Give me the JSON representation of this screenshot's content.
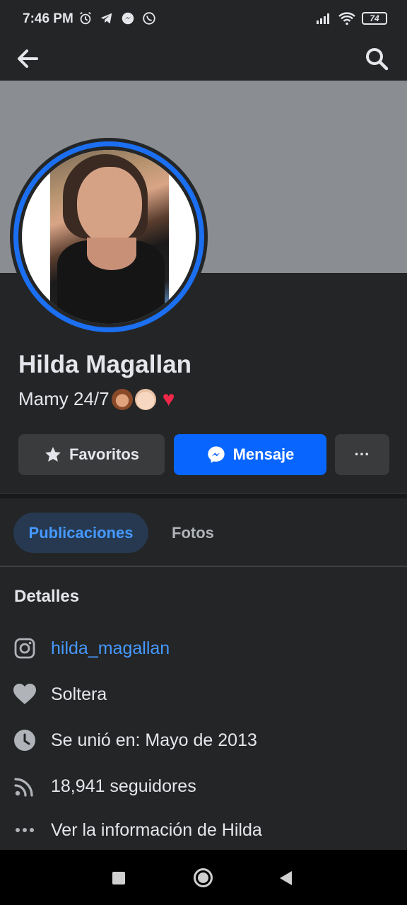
{
  "status_bar": {
    "time": "7:46 PM",
    "left_icons": [
      "alarm-icon",
      "telegram-icon",
      "messenger-icon",
      "whatsapp-icon"
    ],
    "battery": "74"
  },
  "app_bar": {
    "back_icon": "arrow-left-icon",
    "search_icon": "search-icon"
  },
  "profile": {
    "name": "Hilda Magallan",
    "bio": "Mamy 24/7",
    "bio_emojis": [
      "woman-emoji",
      "baby-emoji",
      "red-heart-emoji"
    ]
  },
  "actions": {
    "favorites_label": "Favoritos",
    "message_label": "Mensaje",
    "more_label": "···"
  },
  "tabs": [
    {
      "label": "Publicaciones",
      "active": true
    },
    {
      "label": "Fotos",
      "active": false
    }
  ],
  "details": {
    "title": "Detalles",
    "items": [
      {
        "icon": "instagram-icon",
        "text": "hilda_magallan",
        "link": true
      },
      {
        "icon": "heart-icon",
        "text": "Soltera",
        "link": false
      },
      {
        "icon": "clock-icon",
        "text": "Se unió en: Mayo de 2013",
        "link": false
      },
      {
        "icon": "rss-icon",
        "text": "18,941 seguidores",
        "link": false
      },
      {
        "icon": "ellipsis-icon",
        "text": "Ver la información de Hilda",
        "link": false
      }
    ]
  },
  "colors": {
    "background": "#242526",
    "cover": "#8a8d91",
    "accent": "#0866ff",
    "link": "#4599ff",
    "avatar_ring": "#1b6ff0"
  }
}
